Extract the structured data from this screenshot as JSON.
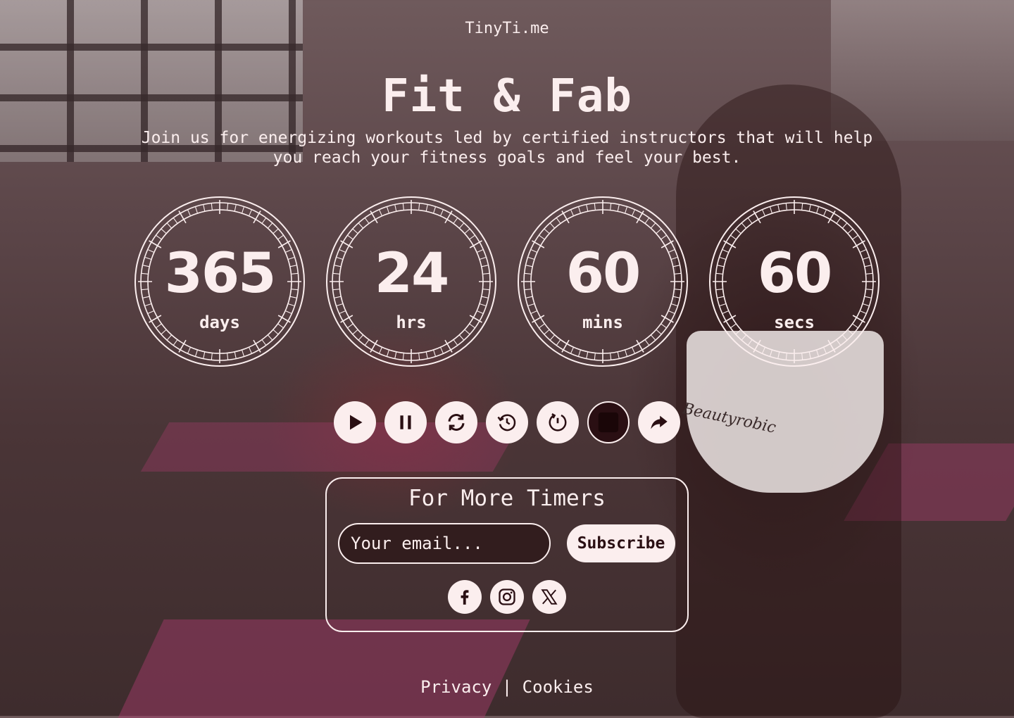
{
  "brand": "TinyTi.me",
  "title": "Fit & Fab",
  "subtitle": "Join us for energizing workouts led by certified instructors that will help you reach your fitness goals and feel your best.",
  "timers": [
    {
      "value": "365",
      "unit": "days"
    },
    {
      "value": "24",
      "unit": "hrs"
    },
    {
      "value": "60",
      "unit": "mins"
    },
    {
      "value": "60",
      "unit": "secs"
    }
  ],
  "controls": [
    {
      "name": "play-icon"
    },
    {
      "name": "pause-icon"
    },
    {
      "name": "refresh-icon"
    },
    {
      "name": "history-icon"
    },
    {
      "name": "clock-reset-icon"
    },
    {
      "name": "stop-icon"
    },
    {
      "name": "share-icon"
    }
  ],
  "subscribe": {
    "heading": "For More Timers",
    "placeholder": "Your email...",
    "button_label": "Subscribe"
  },
  "social": [
    "facebook-icon",
    "instagram-icon",
    "x-icon"
  ],
  "footer": {
    "privacy": "Privacy",
    "separator": "|",
    "cookies": "Cookies"
  },
  "colors": {
    "text": "#fbeeee",
    "dark": "#2a0f13",
    "background": "#4a3537",
    "accent_mat": "#aa3c6e"
  },
  "background_text": "Beautyrobic"
}
